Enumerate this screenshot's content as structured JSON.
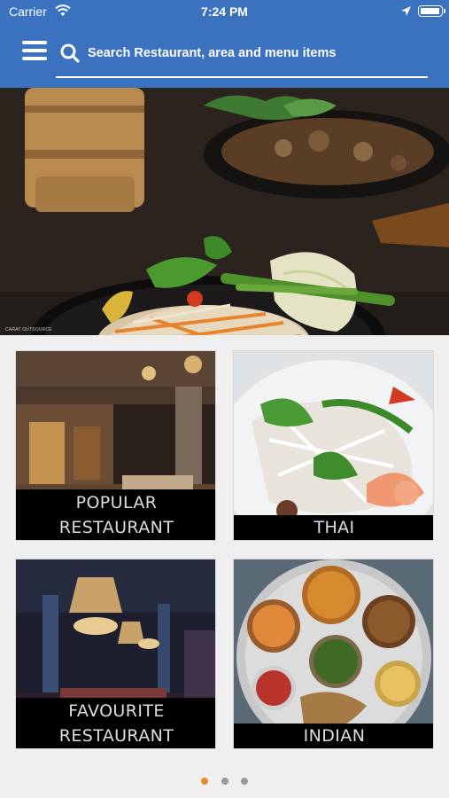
{
  "status": {
    "carrier": "Carrier",
    "time": "7:24 PM"
  },
  "header": {
    "search_placeholder": "Search Restaurant, area and menu items",
    "accent": "#3a72c0"
  },
  "hero": {
    "watermark": "CARAT OUTSOURCE"
  },
  "categories": [
    {
      "line1": "POPULAR",
      "line2": "RESTAURANT"
    },
    {
      "line1": "THAI"
    },
    {
      "line1": "FAVOURITE",
      "line2": "RESTAURANT"
    },
    {
      "line1": "INDIAN"
    }
  ],
  "pager": {
    "active_color": "#e8882c",
    "pages": 3,
    "active_index": 0
  }
}
